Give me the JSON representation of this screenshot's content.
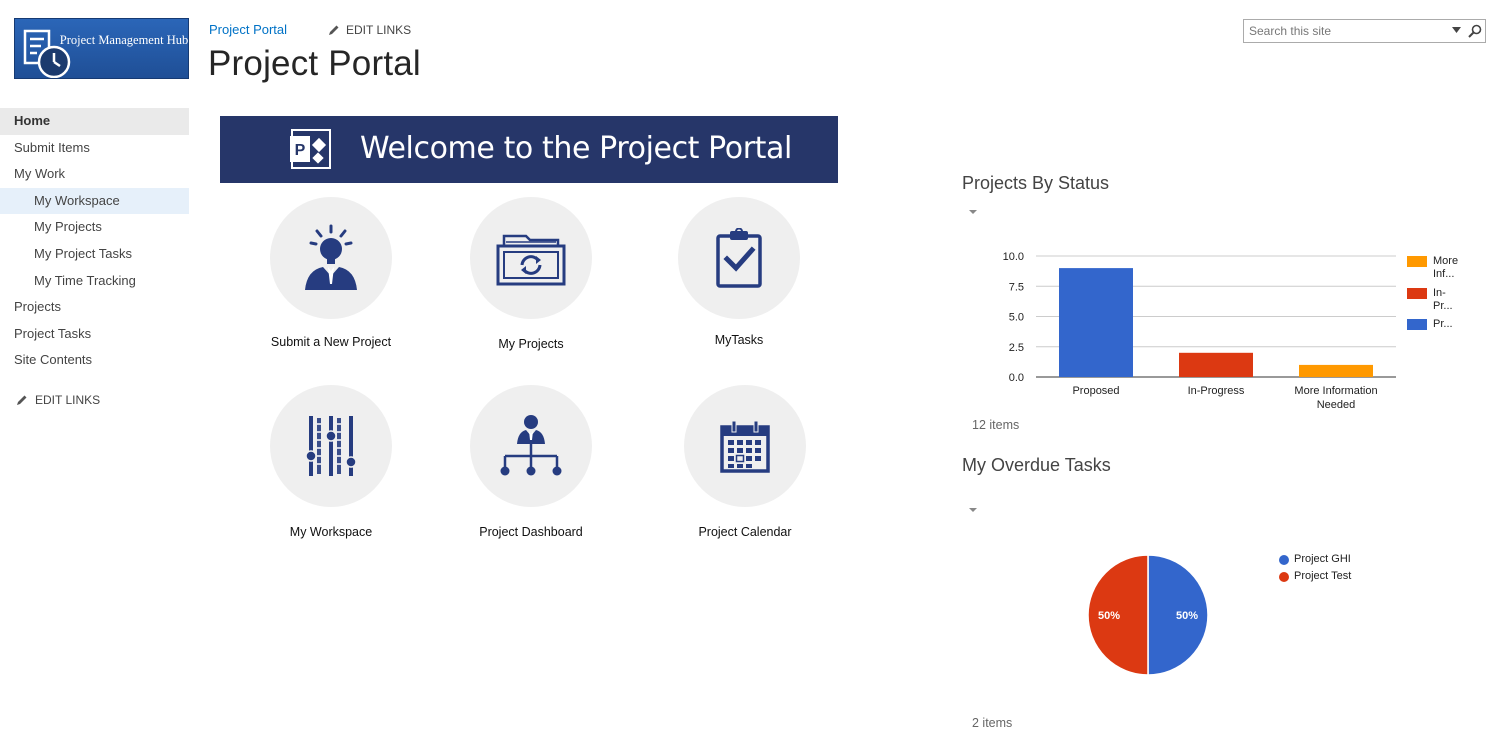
{
  "header": {
    "logo_text": "Project Management Hub",
    "breadcrumb": "Project Portal",
    "edit_links": "EDIT LINKS",
    "page_title": "Project Portal",
    "search_placeholder": "Search this site"
  },
  "nav": {
    "items": [
      {
        "label": "Home",
        "level": 0
      },
      {
        "label": "Submit Items",
        "level": 0
      },
      {
        "label": "My Work",
        "level": 0
      },
      {
        "label": "My Workspace",
        "level": 1
      },
      {
        "label": "My Projects",
        "level": 1
      },
      {
        "label": "My Project Tasks",
        "level": 1
      },
      {
        "label": "My Time Tracking",
        "level": 1
      },
      {
        "label": "Projects",
        "level": 0
      },
      {
        "label": "Project Tasks",
        "level": 0
      },
      {
        "label": "Site Contents",
        "level": 0
      }
    ],
    "edit_links": "EDIT LINKS"
  },
  "banner": {
    "text": "Welcome to the Project Portal",
    "color": "#263669"
  },
  "tiles": [
    {
      "label": "Submit a New Project",
      "icon": "lightbulb-person-icon"
    },
    {
      "label": "My Projects",
      "icon": "folder-refresh-icon"
    },
    {
      "label": "MyTasks",
      "icon": "clipboard-check-icon"
    },
    {
      "label": "My Workspace",
      "icon": "sliders-icon"
    },
    {
      "label": "Project Dashboard",
      "icon": "org-chart-icon"
    },
    {
      "label": "Project Calendar",
      "icon": "calendar-icon"
    }
  ],
  "status_panel": {
    "title": "Projects By Status",
    "items": "12 items"
  },
  "overdue_panel": {
    "title": "My Overdue Tasks",
    "items": "2 items"
  },
  "colors": {
    "accent": "#0072c6",
    "icon_navy": "#263c80",
    "orange": "#ff9900",
    "red": "#dc3912",
    "blue": "#3366cc"
  },
  "chart_data": [
    {
      "type": "bar",
      "title": "Projects By Status",
      "categories": [
        "Proposed",
        "In-Progress",
        "More Information Needed"
      ],
      "category_lines": [
        [
          "Proposed"
        ],
        [
          "In-Progress"
        ],
        [
          "More Information",
          "Needed"
        ]
      ],
      "values": [
        9,
        2,
        1
      ],
      "bar_colors": [
        "#3366cc",
        "#dc3912",
        "#ff9900"
      ],
      "yticks": [
        "10.0",
        "7.5",
        "5.0",
        "2.5",
        "0.0"
      ],
      "ylim": [
        0,
        10
      ],
      "grid": true,
      "legend_position": "right",
      "legend": [
        {
          "lines": [
            "More",
            "Inf..."
          ],
          "color": "#ff9900"
        },
        {
          "lines": [
            "In-",
            "Pr..."
          ],
          "color": "#dc3912"
        },
        {
          "lines": [
            "Pr..."
          ],
          "color": "#3366cc"
        }
      ]
    },
    {
      "type": "pie",
      "title": "My Overdue Tasks",
      "slices": [
        {
          "name": "Project GHI",
          "value": 50,
          "label": "50%",
          "color": "#3366cc"
        },
        {
          "name": "Project Test",
          "value": 50,
          "label": "50%",
          "color": "#dc3912"
        }
      ],
      "legend_position": "right"
    }
  ]
}
